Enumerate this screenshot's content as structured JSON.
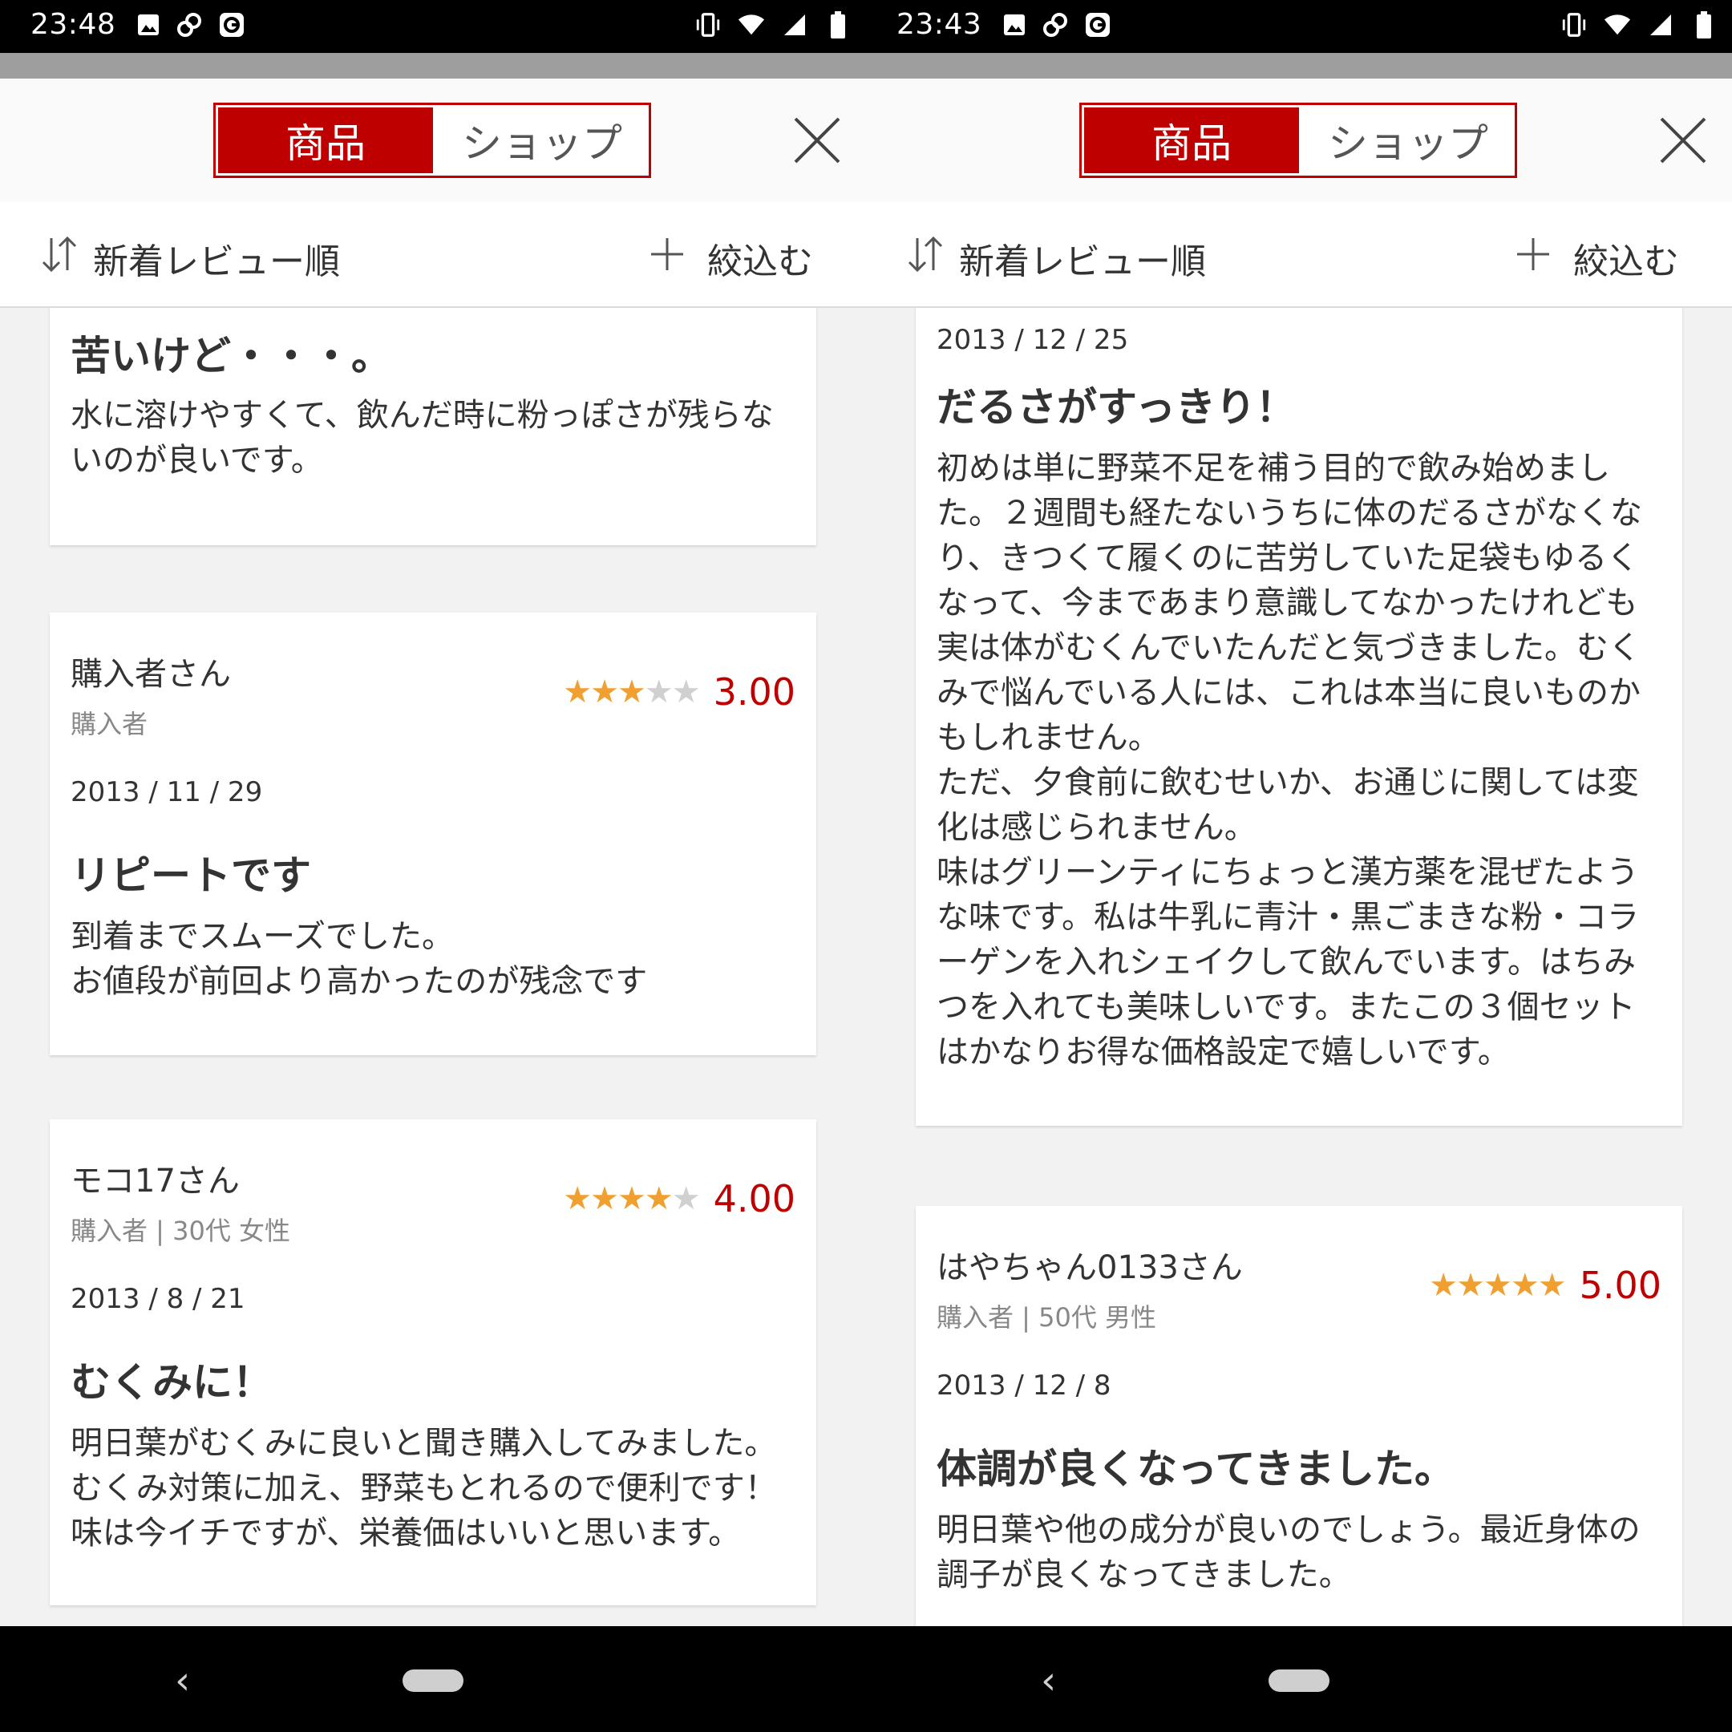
{
  "left": {
    "status": {
      "time": "23:48"
    },
    "tabs": {
      "product": "商品",
      "shop": "ショップ"
    },
    "sort_label": "新着レビュー順",
    "filter_label": "絞込む",
    "review_partial": {
      "title": "苦いけど・・・。",
      "body": "水に溶けやすくて、飲んだ時に粉っぽさが残らないのが良いです。"
    },
    "reviews": [
      {
        "reviewer": "購入者さん",
        "meta": "購入者",
        "rating": 3,
        "score": "3.00",
        "date": "2013 / 11 / 29",
        "title": "リピートです",
        "body": "到着までスムーズでした。\nお値段が前回より高かったのが残念です"
      },
      {
        "reviewer": "モコ17さん",
        "meta": "購入者 | 30代 女性",
        "rating": 4,
        "score": "4.00",
        "date": "2013 / 8 / 21",
        "title": "むくみに！",
        "body": "明日葉がむくみに良いと聞き購入してみました。\nむくみ対策に加え、野菜もとれるので便利です！\n味は今イチですが、栄養価はいいと思います。"
      }
    ]
  },
  "right": {
    "status": {
      "time": "23:43"
    },
    "tabs": {
      "product": "商品",
      "shop": "ショップ"
    },
    "sort_label": "新着レビュー順",
    "filter_label": "絞込む",
    "review_partial": {
      "date": "2013 / 12 / 25",
      "title": "だるさがすっきり！",
      "body": "初めは単に野菜不足を補う目的で飲み始めました。２週間も経たないうちに体のだるさがなくなり、きつくて履くのに苦労していた足袋もゆるくなって、今まであまり意識してなかったけれども実は体がむくんでいたんだと気づきました。むくみで悩んでいる人には、これは本当に良いものかもしれません。\nただ、夕食前に飲むせいか、お通じに関しては変化は感じられません。\n味はグリーンティにちょっと漢方薬を混ぜたような味です。私は牛乳に青汁・黒ごまきな粉・コラーゲンを入れシェイクして飲んでいます。はちみつを入れても美味しいです。またこの３個セットはかなりお得な価格設定で嬉しいです。"
    },
    "reviews": [
      {
        "reviewer": "はやちゃん0133さん",
        "meta": "購入者 | 50代 男性",
        "rating": 5,
        "score": "5.00",
        "date": "2013 / 12 / 8",
        "title": "体調が良くなってきました。",
        "body": "明日葉や他の成分が良いのでしょう。最近身体の調子が良くなってきました。"
      }
    ]
  },
  "colors": {
    "accent": "#bf0000",
    "star": "#f0a030",
    "star_off": "#d0d0d0"
  },
  "icons": [
    "image-icon",
    "link-icon",
    "app-g-icon",
    "vibrate-icon",
    "wifi-icon",
    "signal-icon",
    "battery-icon",
    "sort-icon",
    "plus-icon",
    "close-icon",
    "back-icon",
    "home-pill-icon",
    "star-icon"
  ]
}
